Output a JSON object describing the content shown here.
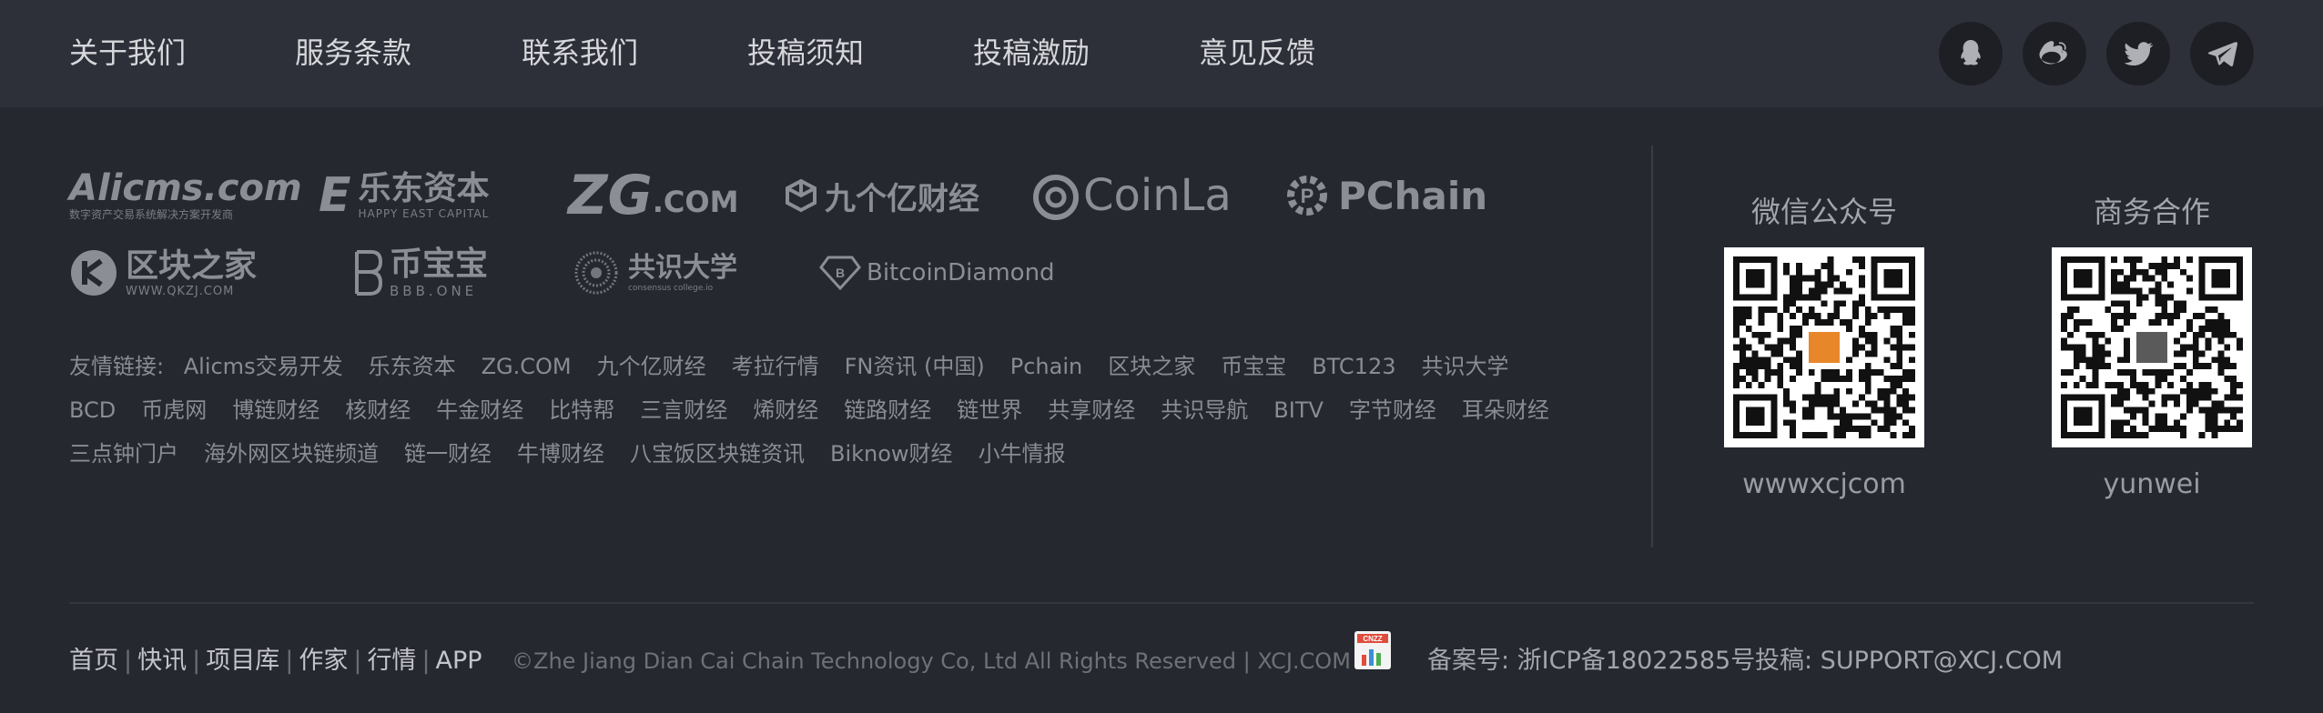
{
  "nav": {
    "about": "关于我们",
    "terms": "服务条款",
    "contact": "联系我们",
    "submission_notice": "投稿须知",
    "submission_incentive": "投稿激励",
    "feedback": "意见反馈"
  },
  "social": {
    "qq": "qq-icon",
    "weibo": "weibo-icon",
    "twitter": "twitter-icon",
    "telegram": "telegram-icon"
  },
  "partners": {
    "alicms": {
      "main": "Alicms.com",
      "sub": "数字资产交易系统解决方案开发商"
    },
    "ledong": {
      "main": "乐东资本",
      "sub": "HAPPY EAST CAPITAL"
    },
    "zg": {
      "main": "ZG",
      "suffix": ".COM"
    },
    "jiugeyi": {
      "main": "九个亿财经"
    },
    "coinla": {
      "main": "CoinLa"
    },
    "pchain": {
      "main": "PChain"
    },
    "qkzj": {
      "main": "区块之家",
      "sub": "WWW.QKZJ.COM"
    },
    "bbb": {
      "main": "币宝宝",
      "sub": "BBB.ONE"
    },
    "gongzhi": {
      "main": "共识大学",
      "sub": "consensus college.io"
    },
    "bitcoindiamond": {
      "main": "BitcoinDiamond"
    }
  },
  "friend_links": {
    "label": "友情链接:",
    "row1": [
      "Alicms交易开发",
      "乐东资本",
      "ZG.COM",
      "九个亿财经",
      "考拉行情",
      "FN资讯 (中国)",
      "Pchain",
      "区块之家",
      "币宝宝",
      "BTC123",
      "共识大学"
    ],
    "row2": [
      "BCD",
      "币虎网",
      "博链财经",
      "核财经",
      "牛金财经",
      "比特帮",
      "三言财经",
      "烯财经",
      "链路财经",
      "链世界",
      "共享财经",
      "共识导航",
      "BITV",
      "字节财经",
      "耳朵财经"
    ],
    "row3": [
      "三点钟门户",
      "海外网区块链频道",
      "链一财经",
      "牛博财经",
      "八宝饭区块链资讯",
      "Biknow财经",
      "小牛情报"
    ]
  },
  "qr": {
    "wechat_title": "微信公众号",
    "wechat_id": "wwwxcjcom",
    "business_title": "商务合作",
    "business_id": "yunwei"
  },
  "bottom": {
    "links": [
      "首页",
      "快讯",
      "项目库",
      "作家",
      "行情",
      "APP"
    ],
    "separator": "|",
    "copyright": "©Zhe Jiang Dian Cai Chain Technology Co, Ltd All Rights Reserved | XCJ.COM",
    "badge_text": "CNZZ",
    "icp": "备案号: 浙ICP备18022585号",
    "contribute": "投稿: SUPPORT@XCJ.COM"
  }
}
